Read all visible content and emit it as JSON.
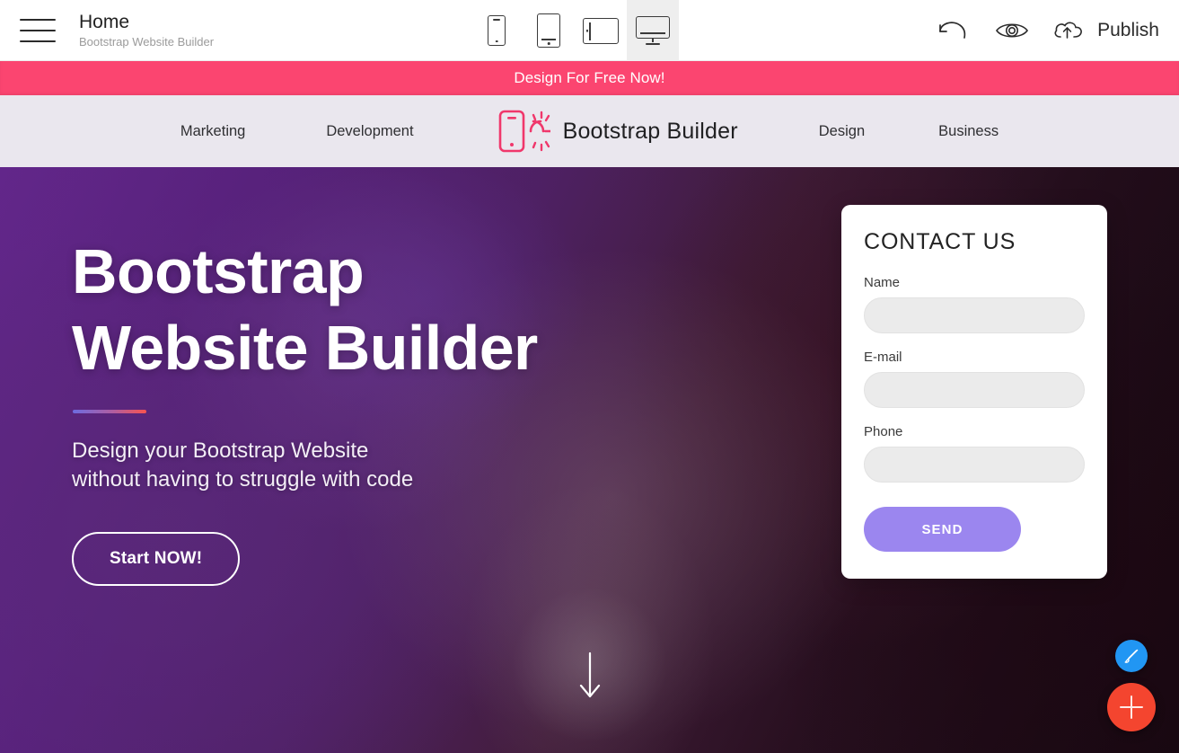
{
  "appbar": {
    "menu_icon": "hamburger-menu-icon",
    "page_title": "Home",
    "page_subtitle": "Bootstrap Website Builder",
    "devices": [
      {
        "name": "mobile",
        "icon": "mobile-phone-icon",
        "active": false
      },
      {
        "name": "tablet-portrait",
        "icon": "tablet-portrait-icon",
        "active": false
      },
      {
        "name": "tablet-landscape",
        "icon": "tablet-landscape-icon",
        "active": false
      },
      {
        "name": "desktop",
        "icon": "desktop-monitor-icon",
        "active": true
      }
    ],
    "undo_icon": "undo-arrow-icon",
    "preview_icon": "eye-preview-icon",
    "publish_icon": "cloud-upload-icon",
    "publish_label": "Publish"
  },
  "promo_banner": {
    "text": "Design For Free Now!",
    "background": "#FB4570",
    "color": "#FFFFFF"
  },
  "site_nav": {
    "background": "#EAE7EE",
    "left_links": [
      {
        "label": "Marketing"
      },
      {
        "label": "Development"
      }
    ],
    "brand": {
      "icon": "phone-rays-logo-icon",
      "icon_color": "#F0376B",
      "name": "Bootstrap Builder"
    },
    "right_links": [
      {
        "label": "Design"
      },
      {
        "label": "Business"
      }
    ]
  },
  "hero": {
    "title_line1": "Bootstrap",
    "title_line2": "Website Builder",
    "divider_gradient": [
      "#6D6CE0",
      "#F8544F"
    ],
    "subtitle_line1": "Design your Bootstrap Website",
    "subtitle_line2": "without having to struggle with code",
    "cta_label": "Start NOW!",
    "scroll_icon": "scroll-down-arrow-icon"
  },
  "contact_form": {
    "title": "CONTACT US",
    "fields": [
      {
        "label": "Name",
        "value": "",
        "placeholder": ""
      },
      {
        "label": "E-mail",
        "value": "",
        "placeholder": ""
      },
      {
        "label": "Phone",
        "value": "",
        "placeholder": ""
      }
    ],
    "submit_label": "SEND",
    "submit_color": "#9B86EF"
  },
  "fabs": [
    {
      "name": "edit-style-fab",
      "icon": "paintbrush-icon",
      "color": "#2196F3"
    },
    {
      "name": "add-block-fab",
      "icon": "plus-icon",
      "color": "#F4452F"
    }
  ]
}
